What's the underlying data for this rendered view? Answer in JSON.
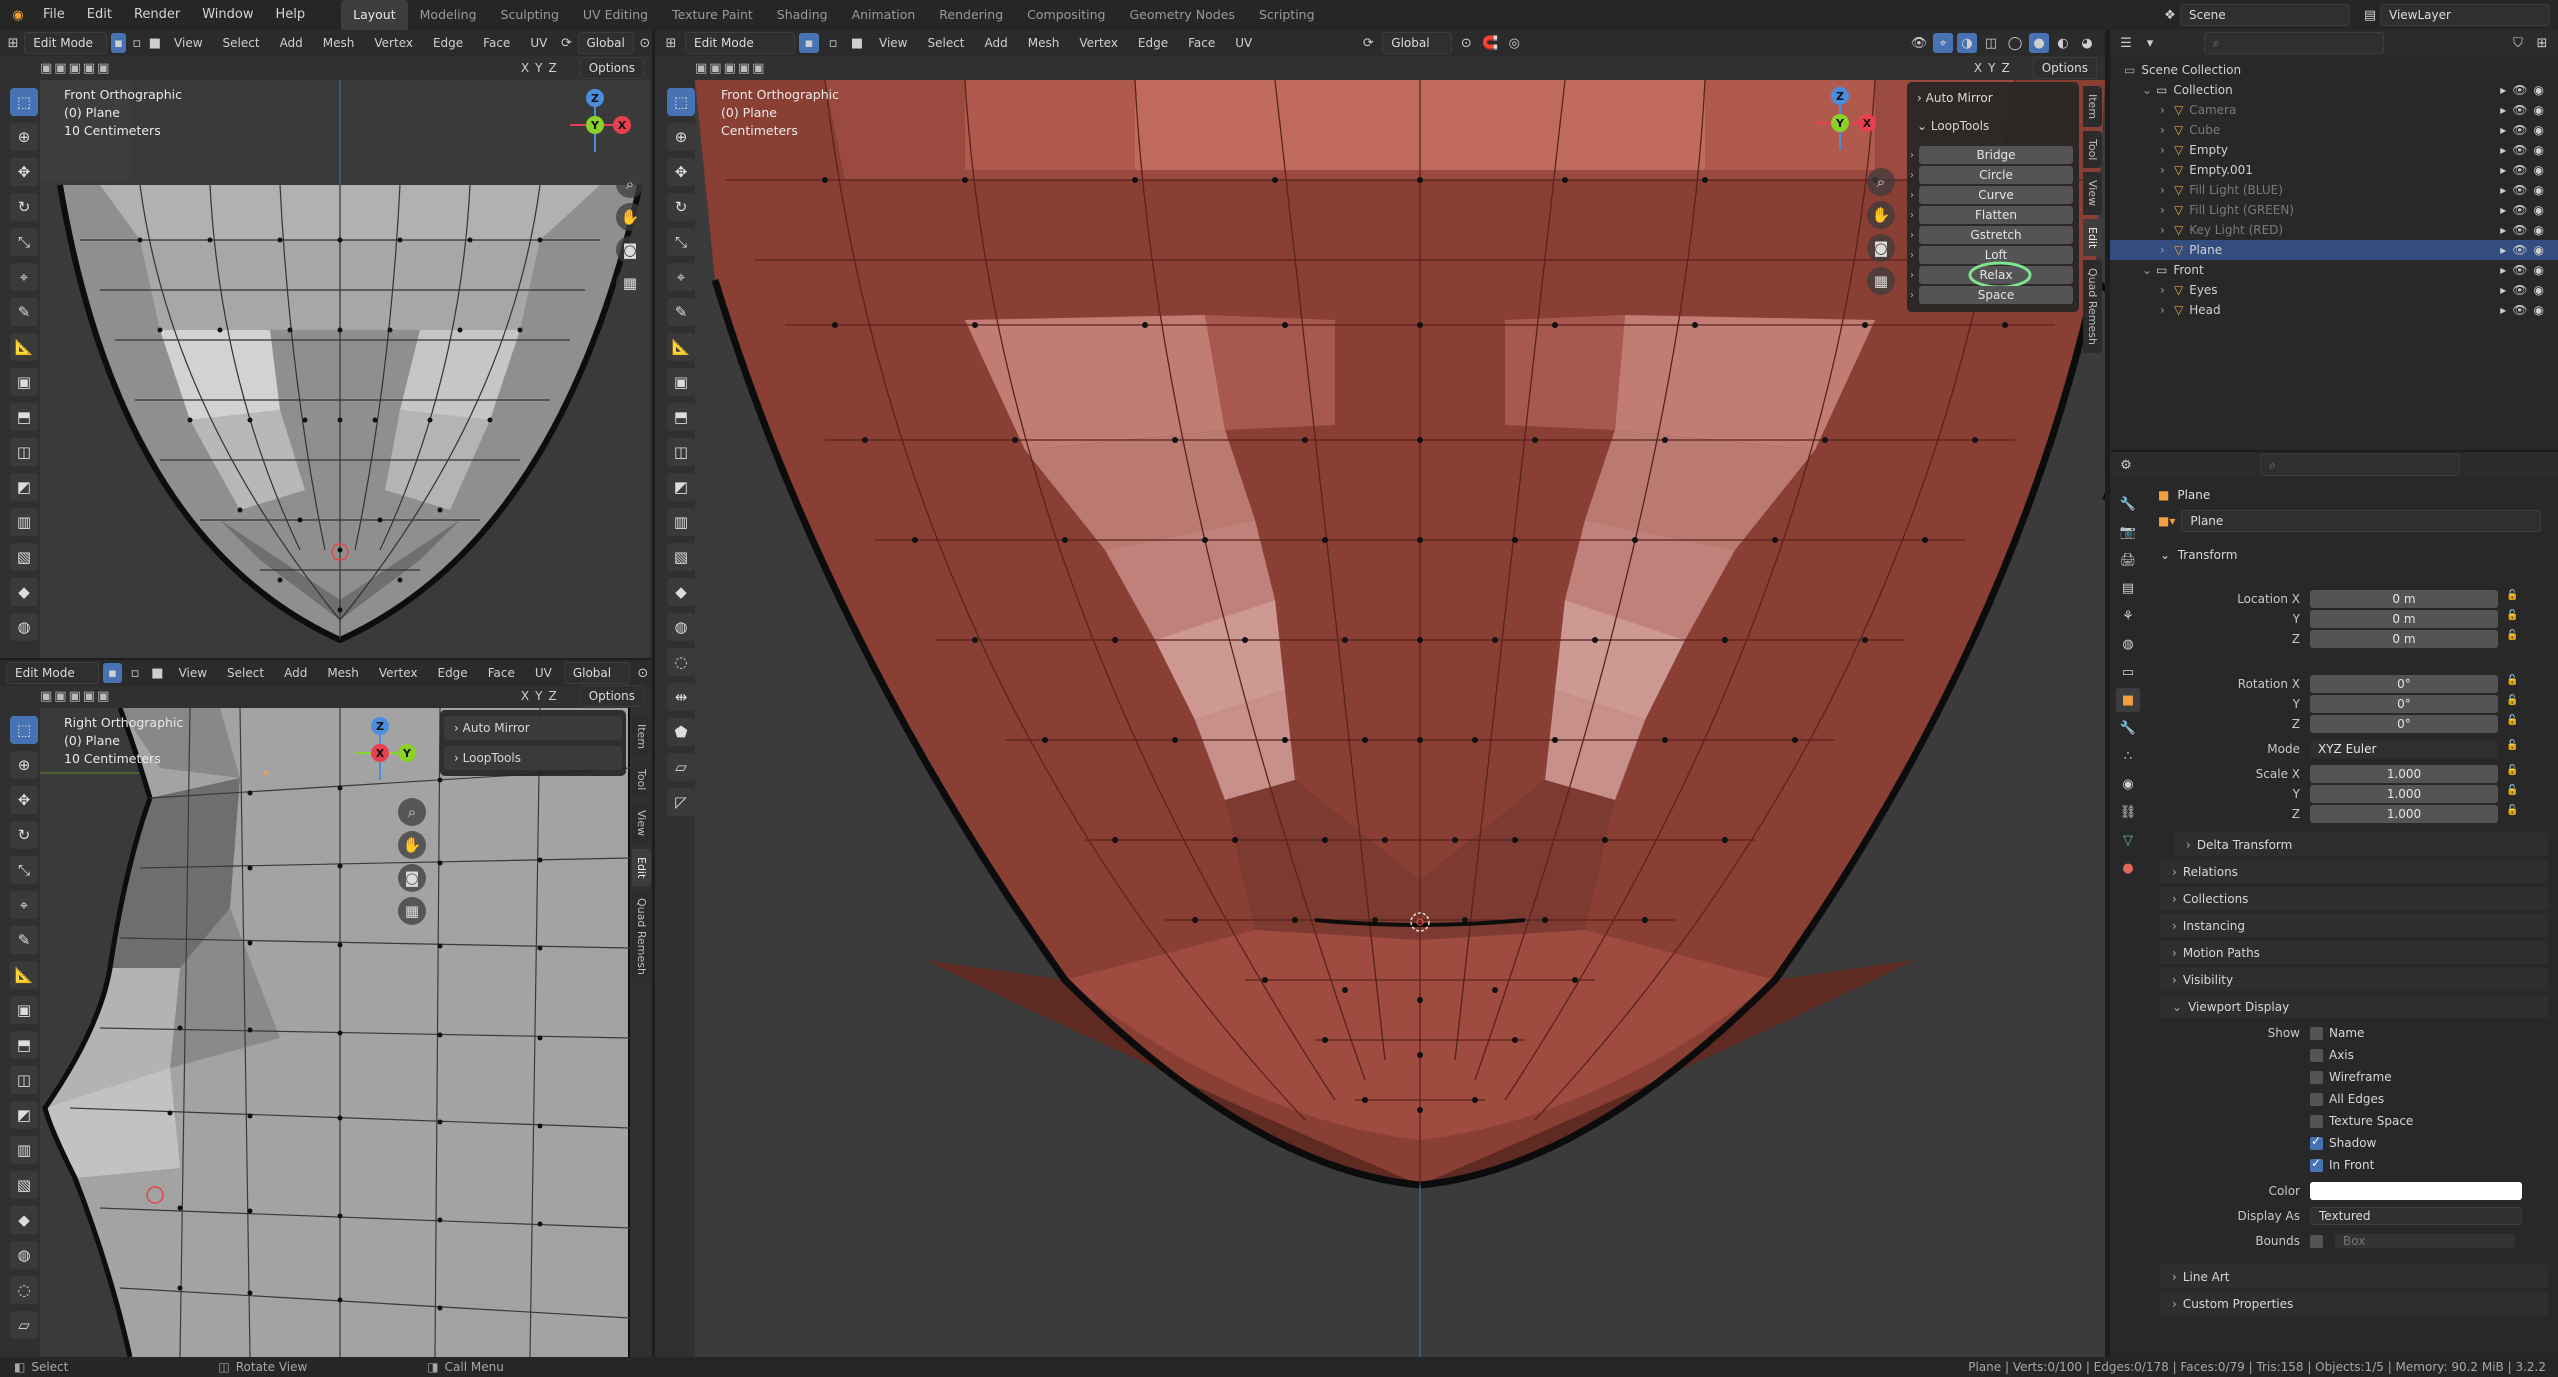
{
  "app": {
    "menus": [
      "File",
      "Edit",
      "Render",
      "Window",
      "Help"
    ],
    "workspaces": [
      "Layout",
      "Modeling",
      "Sculpting",
      "UV Editing",
      "Texture Paint",
      "Shading",
      "Animation",
      "Rendering",
      "Compositing",
      "Geometry Nodes",
      "Scripting"
    ],
    "active_workspace": "Layout",
    "scene": "Scene",
    "view_layer": "ViewLayer"
  },
  "viewport_header": {
    "mode": "Edit Mode",
    "menus": [
      "View",
      "Select",
      "Add",
      "Mesh",
      "Vertex",
      "Edge",
      "Face",
      "UV"
    ],
    "orientation": "Global",
    "options": "Options",
    "axes": [
      "X",
      "Y",
      "Z"
    ]
  },
  "top_left_viewport": {
    "view_name": "Front Orthographic",
    "object": "(0) Plane",
    "scale": "10 Centimeters"
  },
  "bottom_left_viewport": {
    "view_name": "Right Orthographic",
    "object": "(0) Plane",
    "scale": "10 Centimeters",
    "panels": [
      "Auto Mirror",
      "LoopTools"
    ]
  },
  "main_viewport": {
    "view_name": "Front Orthographic",
    "object": "(0) Plane",
    "scale": "Centimeters",
    "auto_mirror": "Auto Mirror",
    "looptools": {
      "title": "LoopTools",
      "buttons": [
        "Bridge",
        "Circle",
        "Curve",
        "Flatten",
        "Gstretch",
        "Loft",
        "Relax",
        "Space"
      ],
      "highlighted": "Relax"
    },
    "sidebar_tabs": [
      "Item",
      "Tool",
      "View",
      "Edit",
      "Quad Remesh"
    ]
  },
  "outliner": {
    "scene_collection": "Scene Collection",
    "rows": [
      {
        "name": "Collection",
        "depth": 1,
        "muted": false,
        "selected": false
      },
      {
        "name": "Camera",
        "depth": 2,
        "muted": true,
        "selected": false
      },
      {
        "name": "Cube",
        "depth": 2,
        "muted": true,
        "selected": false
      },
      {
        "name": "Empty",
        "depth": 2,
        "muted": false,
        "selected": false
      },
      {
        "name": "Empty.001",
        "depth": 2,
        "muted": false,
        "selected": false
      },
      {
        "name": "Fill Light (BLUE)",
        "depth": 2,
        "muted": true,
        "selected": false
      },
      {
        "name": "Fill Light (GREEN)",
        "depth": 2,
        "muted": true,
        "selected": false
      },
      {
        "name": "Key Light (RED)",
        "depth": 2,
        "muted": true,
        "selected": false
      },
      {
        "name": "Plane",
        "depth": 2,
        "muted": false,
        "selected": true
      },
      {
        "name": "Front",
        "depth": 1,
        "muted": false,
        "selected": false
      },
      {
        "name": "Eyes",
        "depth": 2,
        "muted": false,
        "selected": false
      },
      {
        "name": "Head",
        "depth": 2,
        "muted": false,
        "selected": false
      }
    ]
  },
  "properties": {
    "object_name": "Plane",
    "data_name": "Plane",
    "transform_title": "Transform",
    "location": {
      "label": "Location X",
      "x": "0 m",
      "y": "0 m",
      "z": "0 m"
    },
    "rotation": {
      "label": "Rotation X",
      "x": "0°",
      "y": "0°",
      "z": "0°"
    },
    "mode_label": "Mode",
    "mode": "XYZ Euler",
    "scale": {
      "label": "Scale X",
      "x": "1.000",
      "y": "1.000",
      "z": "1.000"
    },
    "axis_y": "Y",
    "axis_z": "Z",
    "delta_transform": "Delta Transform",
    "panels": [
      "Relations",
      "Collections",
      "Instancing",
      "Motion Paths",
      "Visibility"
    ],
    "viewport_display": {
      "title": "Viewport Display",
      "show_label": "Show",
      "checks": [
        {
          "label": "Name",
          "on": false
        },
        {
          "label": "Axis",
          "on": false
        },
        {
          "label": "Wireframe",
          "on": false
        },
        {
          "label": "All Edges",
          "on": false
        },
        {
          "label": "Texture Space",
          "on": false
        },
        {
          "label": "Shadow",
          "on": true
        },
        {
          "label": "In Front",
          "on": true
        }
      ],
      "color_label": "Color",
      "display_as_label": "Display As",
      "display_as": "Textured",
      "bounds_label": "Bounds",
      "bounds_value": "Box"
    },
    "bottom_panels": [
      "Line Art",
      "Custom Properties"
    ]
  },
  "status_bar": {
    "select": "Select",
    "rotate": "Rotate View",
    "menu": "Call Menu",
    "stats": "Plane | Verts:0/100 | Edges:0/178 | Faces:0/79 | Tris:158 | Objects:1/5 | Memory: 90.2 MiB | 3.2.2"
  },
  "colors": {
    "accent": "#4772b3",
    "mesh_red": "#8e4236",
    "mesh_grey": "#9a9a9a",
    "highlight_circle": "#7de38f",
    "x_axis": "#e8404f",
    "y_axis": "#8ad12a",
    "z_axis": "#4a8ee0"
  }
}
